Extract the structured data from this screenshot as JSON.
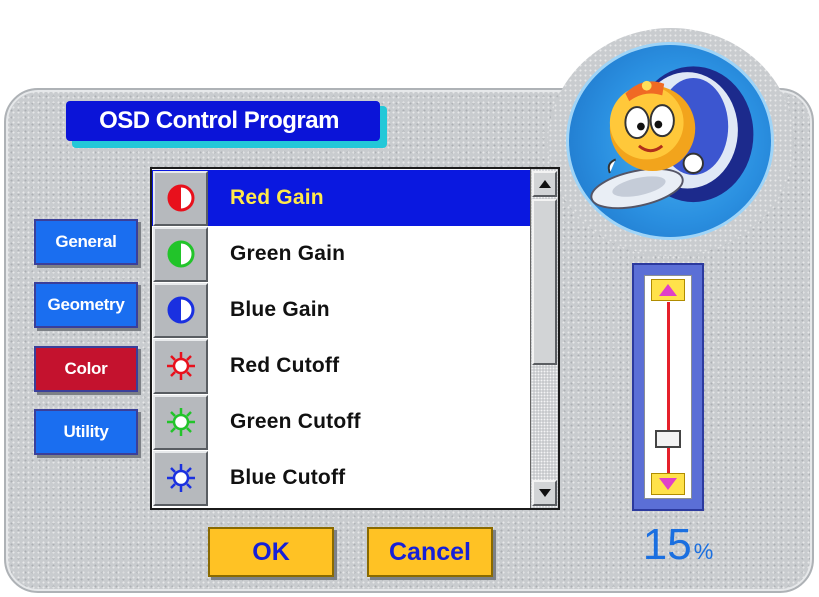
{
  "title": "OSD Control Program",
  "tabs": [
    {
      "label": "General",
      "active": false
    },
    {
      "label": "Geometry",
      "active": false
    },
    {
      "label": "Color",
      "active": true
    },
    {
      "label": "Utility",
      "active": false
    }
  ],
  "list": {
    "selected_index": 0,
    "items": [
      {
        "label": "Red Gain",
        "icon": "red-half-circle-icon",
        "color": "#e8101c"
      },
      {
        "label": "Green Gain",
        "icon": "green-half-circle-icon",
        "color": "#22c42a"
      },
      {
        "label": "Blue Gain",
        "icon": "blue-half-circle-icon",
        "color": "#1a30e0"
      },
      {
        "label": "Red Cutoff",
        "icon": "red-sun-icon",
        "color": "#e8101c"
      },
      {
        "label": "Green Cutoff",
        "icon": "green-sun-icon",
        "color": "#22c42a"
      },
      {
        "label": "Blue Cutoff",
        "icon": "blue-sun-icon",
        "color": "#1a30e0"
      }
    ]
  },
  "buttons": {
    "ok": "OK",
    "cancel": "Cancel"
  },
  "slider": {
    "value": 15,
    "unit": "%"
  },
  "colors": {
    "title_bg": "#0b14d8",
    "tab_blue": "#1a6ef0",
    "tab_active": "#c4122e",
    "selection": "#0a18e0",
    "selected_text": "#ffe94a",
    "button_bg": "#ffc224",
    "button_text": "#1620d8",
    "percent": "#1a6fe0"
  }
}
